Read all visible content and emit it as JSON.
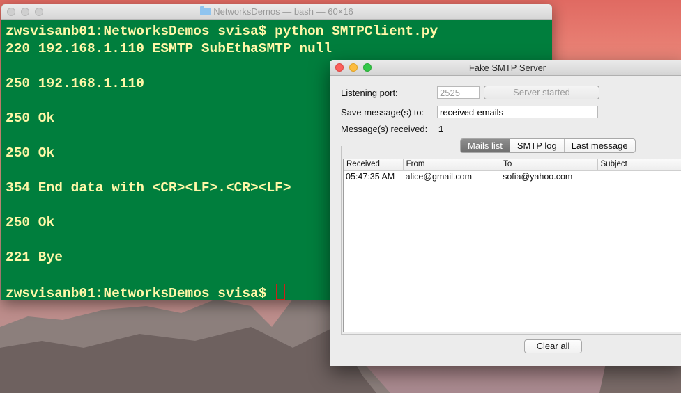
{
  "terminal": {
    "title": "NetworksDemos — bash — 60×16",
    "lines": [
      "zwsvisanb01:NetworksDemos svisa$ python SMTPClient.py",
      "220 192.168.1.110 ESMTP SubEthaSMTP null",
      "",
      "250 192.168.1.110",
      "",
      "250 Ok",
      "",
      "250 Ok",
      "",
      "354 End data with <CR><LF>.<CR><LF>",
      "",
      "250 Ok",
      "",
      "221 Bye",
      "",
      "zwsvisanb01:NetworksDemos svisa$ "
    ]
  },
  "smtp": {
    "title": "Fake SMTP Server",
    "port_label": "Listening port:",
    "port_value": "2525",
    "server_button": "Server started",
    "save_label": "Save message(s) to:",
    "save_value": "received-emails",
    "received_label": "Message(s) received:",
    "received_count": "1",
    "tabs": [
      "Mails list",
      "SMTP log",
      "Last message"
    ],
    "active_tab": "Mails list",
    "columns": [
      "Received",
      "From",
      "To",
      "Subject"
    ],
    "rows": [
      [
        "05:47:35 AM",
        "alice@gmail.com",
        "sofia@yahoo.com",
        ""
      ]
    ],
    "clear_button": "Clear all"
  },
  "colors": {
    "terminal_bg": "#007e3d",
    "terminal_text": "#fff7a8",
    "active_tab": "#7d7d7d"
  }
}
